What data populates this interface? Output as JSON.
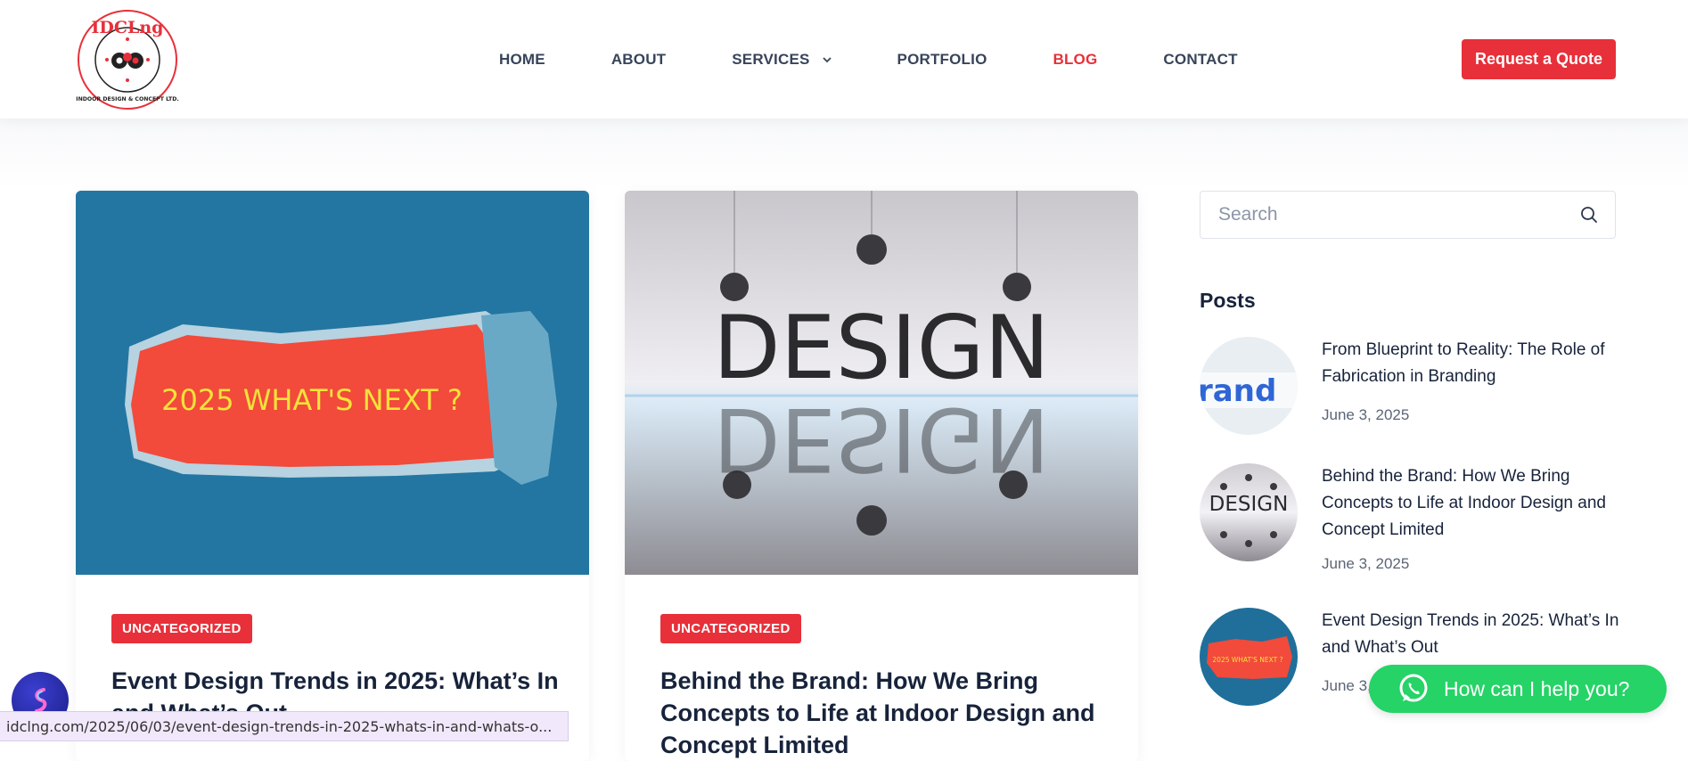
{
  "logo": {
    "text_top": "IDCLng",
    "text_ring": "INDOOR DESIGN & CONCEPT LTD."
  },
  "nav": {
    "items": [
      {
        "label": "HOME",
        "active": false
      },
      {
        "label": "ABOUT",
        "active": false
      },
      {
        "label": "SERVICES",
        "active": false,
        "has_dropdown": true
      },
      {
        "label": "PORTFOLIO",
        "active": false
      },
      {
        "label": "BLOG",
        "active": true
      },
      {
        "label": "CONTACT",
        "active": false
      }
    ],
    "quote_button": "Request a Quote"
  },
  "colors": {
    "accent": "#e8303a",
    "heading": "#17233b",
    "whatsapp": "#25d366"
  },
  "cards": [
    {
      "image_text": "2025 WHAT'S NEXT ?",
      "category": "UNCATEGORIZED",
      "title": "Event Design Trends in 2025: What’s In and What’s Out"
    },
    {
      "image_text": "DESIGN",
      "category": "UNCATEGORIZED",
      "title": "Behind the Brand: How We Bring Concepts to Life at Indoor Design and Concept Limited"
    }
  ],
  "sidebar": {
    "search_placeholder": "Search",
    "posts_heading": "Posts",
    "posts": [
      {
        "title": "From Blueprint to Reality: The Role of Fabrication in Branding",
        "date": "June 3, 2025",
        "thumb_text": "brand"
      },
      {
        "title": "Behind the Brand: How We Bring Concepts to Life at Indoor Design and Concept Limited",
        "date": "June 3, 2025",
        "thumb_text": "DESIGN"
      },
      {
        "title": "Event Design Trends in 2025: What’s In and What’s Out",
        "date": "June 3, 2025",
        "thumb_text": "2025 WHAT'S NEXT ?"
      }
    ]
  },
  "status_url": "idclng.com/2025/06/03/event-design-trends-in-2025-whats-in-and-whats-o...",
  "whatsapp": {
    "label": "How can I help you?",
    "icon": "whatsapp-icon"
  },
  "chat_widget": {
    "icon": "chat-widget-icon"
  }
}
